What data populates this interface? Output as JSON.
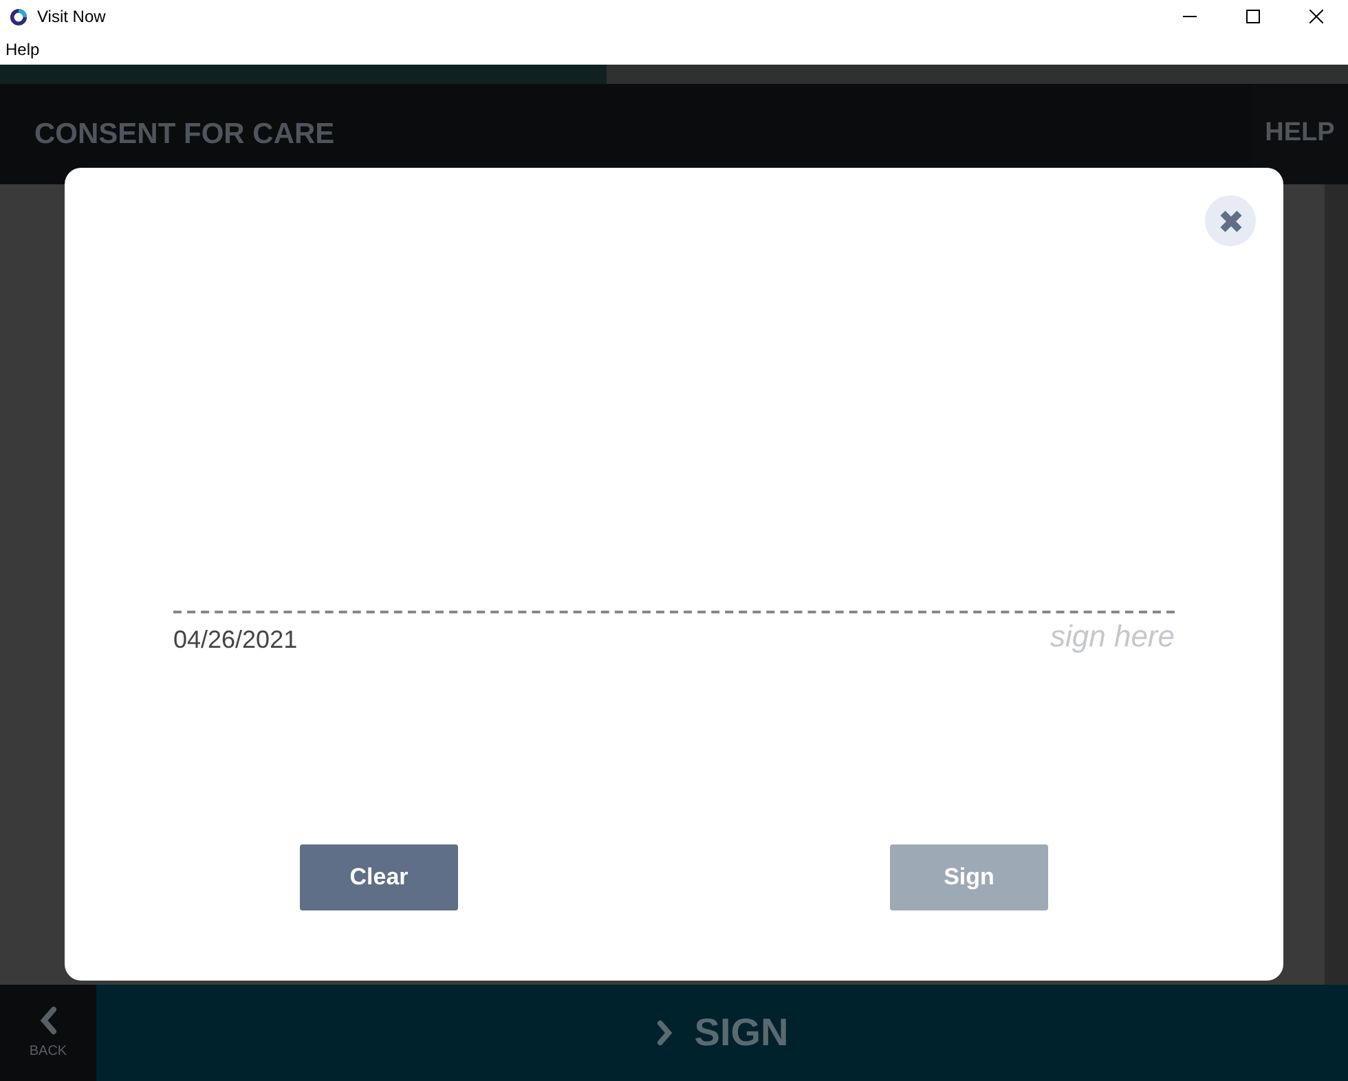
{
  "window": {
    "title": "Visit Now"
  },
  "menu": [
    "Help"
  ],
  "progress": {
    "level": 0.45
  },
  "header": {
    "title": "CONSENT FOR CARE",
    "help": "HELP"
  },
  "footer": {
    "back": "BACK",
    "next": "SIGN"
  },
  "dialog": {
    "date": "04/26/2021",
    "hint": "sign here",
    "buttons": [
      {
        "label": "Clear",
        "disabled": false
      },
      {
        "label": "Sign",
        "disabled": true
      }
    ]
  }
}
